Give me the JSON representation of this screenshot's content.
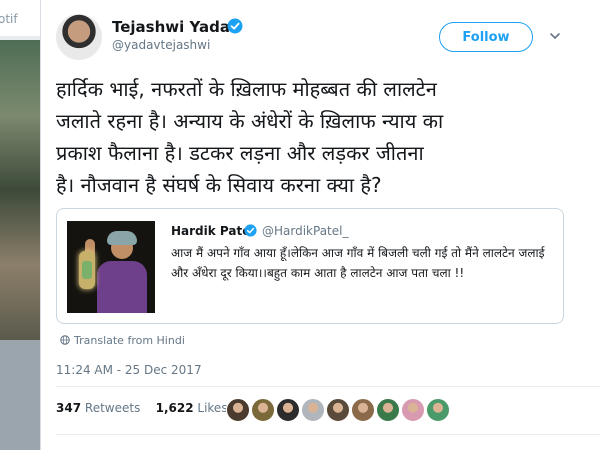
{
  "left_strip": {
    "fragment": "otif"
  },
  "tweet": {
    "author_name": "Tejashwi Yadav",
    "author_handle": "@yadavtejashwi",
    "follow_label": "Follow",
    "text_lines": [
      "हार्दिक भाई, नफरतों के ख़िलाफ मोहब्बत की लालटेन",
      "जलाते रहना है। अन्याय के अंधेरों के ख़िलाफ न्याय का",
      "प्रकाश फैलाना है। डटकर लड़ना और लड़कर जीतना",
      "है। नौजवान है संघर्ष के सिवाय करना क्या है?"
    ],
    "quoted": {
      "name": "Hardik Patel",
      "handle": "@HardikPatel_",
      "text": "आज मैं अपने गाँव आया हूँ।लेकिन आज गाँव में बिजली चली गई तो मैंने लालटेन जलाई और अँधेरा दूर किया।।बहुत काम आता है लालटेन आज पता चला !!"
    },
    "translate_label": "Translate from Hindi",
    "timestamp": "11:24 AM - 25 Dec 2017",
    "retweets_count": "347",
    "retweets_label": "Retweets",
    "likes_count": "1,622",
    "likes_label": "Likes"
  },
  "colors": {
    "accent": "#1da1f2",
    "text": "#14171a",
    "muted": "#657786"
  },
  "icons": [
    "verified-badge-icon",
    "chevron-down-icon",
    "globe-icon"
  ],
  "liker_avatars": [
    "#4b3b2e",
    "#7a6a3a",
    "#2c2c2c",
    "#b0b6bc",
    "#5a4a3a",
    "#8a6a4a",
    "#3a7a4a",
    "#d89ab0",
    "#4a9a6a"
  ]
}
